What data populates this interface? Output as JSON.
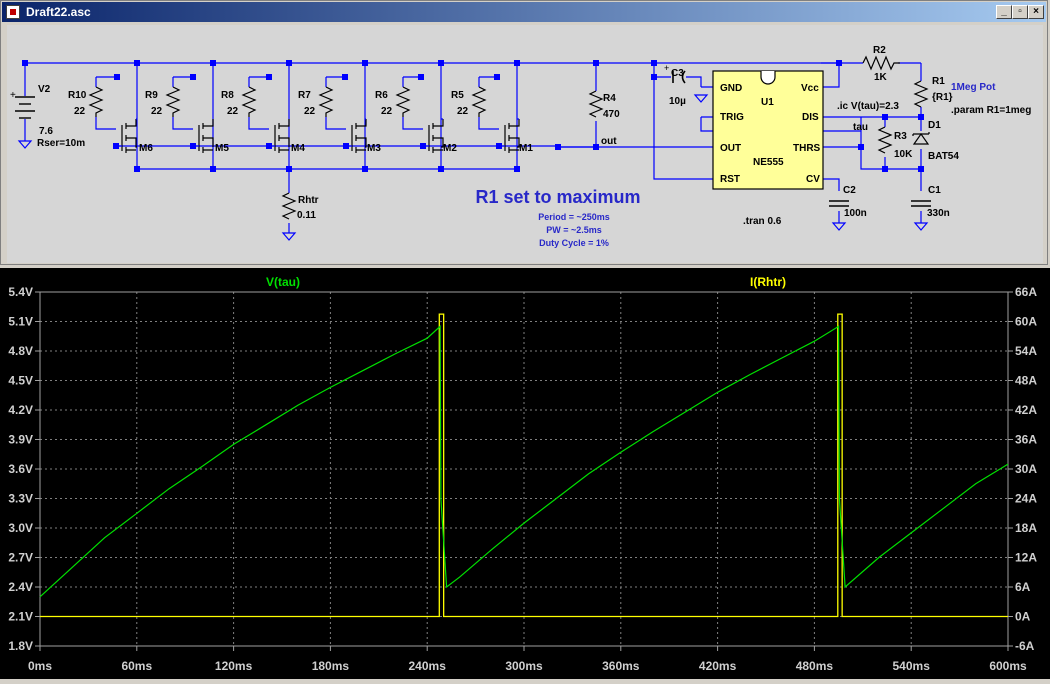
{
  "window": {
    "title": "Draft22.asc",
    "minimize_icon": "minimize-icon",
    "restore_icon": "restore-icon",
    "close_icon": "close-icon"
  },
  "schematic": {
    "components": {
      "v2_name": "V2",
      "v2_value": "7.6",
      "v2_rser": "Rser=10m",
      "resistors": [
        {
          "name": "R10",
          "value": "22"
        },
        {
          "name": "R9",
          "value": "22"
        },
        {
          "name": "R8",
          "value": "22"
        },
        {
          "name": "R7",
          "value": "22"
        },
        {
          "name": "R6",
          "value": "22"
        },
        {
          "name": "R5",
          "value": "22"
        }
      ],
      "mosfets": [
        "M6",
        "M5",
        "M4",
        "M3",
        "M2",
        "M1"
      ],
      "rhtr_name": "Rhtr",
      "rhtr_value": "0.11",
      "r4_name": "R4",
      "r4_value": "470",
      "out_label": "out",
      "c3_name": "C3",
      "c3_value": "10µ",
      "u1_name": "U1",
      "u1_part": "NE555",
      "u1_pins": {
        "gnd": "GND",
        "vcc": "Vcc",
        "trig": "TRIG",
        "dis": "DIS",
        "out": "OUT",
        "thrs": "THRS",
        "rst": "RST",
        "cv": "CV"
      },
      "c2_name": "C2",
      "c2_value": "100n",
      "r2_name": "R2",
      "r2_value": "1K",
      "r1_name": "R1",
      "r1_value": "{R1}",
      "pot_label": "1Meg Pot",
      "param": ".param R1=1meg",
      "ic": ".ic V(tau)=2.3",
      "tau_label": "tau",
      "r3_name": "R3",
      "r3_value": "10K",
      "d1_name": "D1",
      "d1_part": "BAT54",
      "c1_name": "C1",
      "c1_value": "330n",
      "tran": ".tran 0.6"
    },
    "annotation": {
      "headline": "R1 set to maximum",
      "lines": [
        "Period = ~250ms",
        "PW =  ~2.5ms",
        "Duty Cycle = 1%"
      ]
    }
  },
  "plot": {
    "colors": {
      "v_tau": "#00e000",
      "i_rhtr": "#ffff00",
      "axis": "#a0a0a0",
      "grid": "#808080",
      "label": "#d0d0d0"
    },
    "trace_labels": {
      "left": "V(tau)",
      "right": "I(Rhtr)"
    },
    "left_ticks": [
      "5.4V",
      "5.1V",
      "4.8V",
      "4.5V",
      "4.2V",
      "3.9V",
      "3.6V",
      "3.3V",
      "3.0V",
      "2.7V",
      "2.4V",
      "2.1V",
      "1.8V"
    ],
    "right_ticks": [
      "66A",
      "60A",
      "54A",
      "48A",
      "42A",
      "36A",
      "30A",
      "24A",
      "18A",
      "12A",
      "6A",
      "0A",
      "-6A"
    ],
    "x_ticks": [
      "0ms",
      "60ms",
      "120ms",
      "180ms",
      "240ms",
      "300ms",
      "360ms",
      "420ms",
      "480ms",
      "540ms",
      "600ms"
    ]
  },
  "chart_data": {
    "type": "line",
    "x_unit": "ms",
    "xlim": [
      0,
      600
    ],
    "ylim_left": [
      1.8,
      5.4
    ],
    "ylim_right": [
      -6,
      66
    ],
    "series": [
      {
        "name": "V(tau)",
        "axis": "left",
        "x": [
          0,
          20,
          40,
          60,
          80,
          100,
          120,
          140,
          160,
          180,
          200,
          220,
          240,
          248,
          248.5,
          252,
          260,
          280,
          300,
          320,
          340,
          360,
          380,
          400,
          420,
          440,
          460,
          480,
          495,
          495.5,
          499,
          520,
          540,
          560,
          580,
          600
        ],
        "y": [
          2.3,
          2.6,
          2.9,
          3.15,
          3.4,
          3.62,
          3.85,
          4.05,
          4.25,
          4.43,
          4.6,
          4.77,
          4.93,
          5.05,
          3.3,
          2.4,
          2.5,
          2.78,
          3.05,
          3.3,
          3.55,
          3.77,
          3.98,
          4.18,
          4.38,
          4.56,
          4.73,
          4.9,
          5.05,
          3.3,
          2.4,
          2.7,
          2.95,
          3.2,
          3.45,
          3.65
        ]
      },
      {
        "name": "I(Rhtr)",
        "axis": "right",
        "x": [
          0,
          247.5,
          247.6,
          250.2,
          250.3,
          600
        ],
        "y": [
          0,
          0,
          61.5,
          61.5,
          0,
          0
        ],
        "pulses": [
          [
            247.5,
            250.2
          ],
          [
            494.5,
            497.2
          ]
        ],
        "pulse_height": 61.5
      }
    ]
  }
}
